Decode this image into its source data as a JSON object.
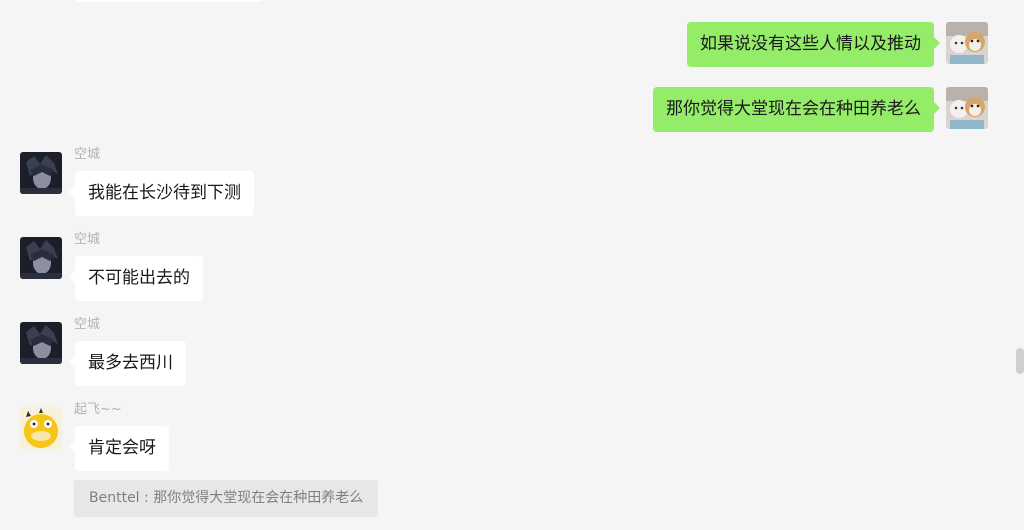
{
  "messages": [
    {
      "side": "right",
      "text": "如果说没有这些人情以及推动"
    },
    {
      "side": "right",
      "text": "那你觉得大堂现在会在种田养老么"
    },
    {
      "side": "left",
      "sender": "空城",
      "text": "我能在长沙待到下测"
    },
    {
      "side": "left",
      "sender": "空城",
      "text": "不可能出去的"
    },
    {
      "side": "left",
      "sender": "空城",
      "text": "最多去西川"
    },
    {
      "side": "left",
      "sender": "起飞~~",
      "text": "肯定会呀"
    }
  ],
  "quote": {
    "text": "Benttel : 那你觉得大堂现在会在种田养老么"
  },
  "colors": {
    "background": "#f5f5f5",
    "self_bubble": "#95ec69",
    "other_bubble": "#ffffff",
    "sender_name": "#b2b2b2",
    "quote_bg": "#e7e7e7"
  },
  "avatars": {
    "self": "cat-dog-photo-avatar",
    "kongcheng": "dark-anime-avatar",
    "qifei": "yellow-duck-avatar"
  }
}
